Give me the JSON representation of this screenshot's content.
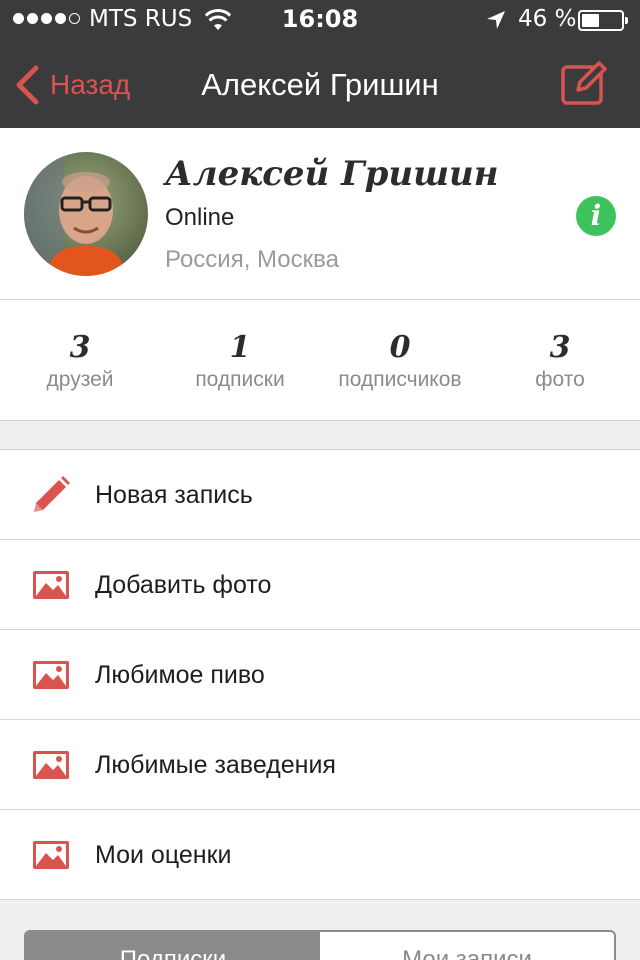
{
  "status_bar": {
    "carrier": "MTS RUS",
    "time": "16:08",
    "battery_percent": "46 %",
    "battery_level": 0.46
  },
  "nav": {
    "back_label": "Назад",
    "title": "Алексей Гришин"
  },
  "profile": {
    "name": "Алексей Гришин",
    "status": "Online",
    "location": "Россия, Москва",
    "info_glyph": "i"
  },
  "stats": [
    {
      "value": "3",
      "label": "друзей"
    },
    {
      "value": "1",
      "label": "подписки"
    },
    {
      "value": "0",
      "label": "подписчиков"
    },
    {
      "value": "3",
      "label": "фото"
    }
  ],
  "menu": [
    {
      "label": "Новая запись",
      "icon": "pencil-icon"
    },
    {
      "label": "Добавить фото",
      "icon": "image-icon"
    },
    {
      "label": "Любимое пиво",
      "icon": "image-icon"
    },
    {
      "label": "Любимые заведения",
      "icon": "image-icon"
    },
    {
      "label": "Мои оценки",
      "icon": "image-icon"
    }
  ],
  "tabs": {
    "active": "Подписки",
    "inactive": "Мои записи"
  },
  "colors": {
    "accent": "#d9534f",
    "navbar": "#3b3b3d",
    "online": "#3ec25c"
  }
}
